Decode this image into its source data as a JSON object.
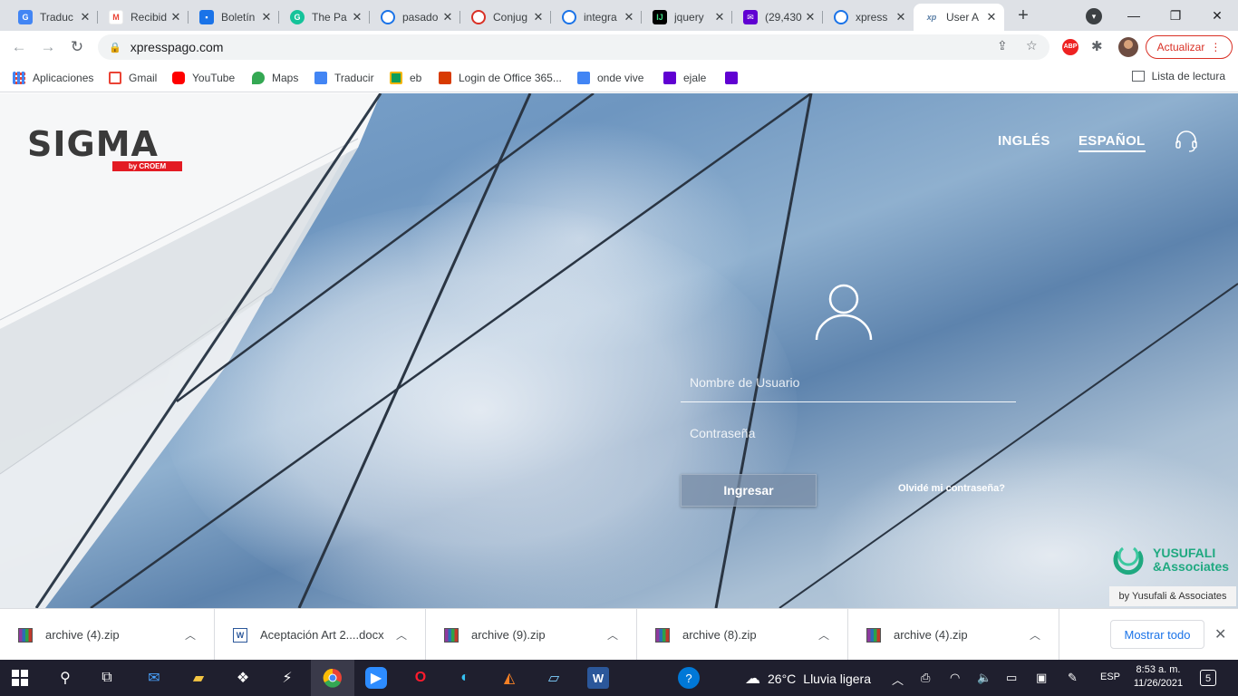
{
  "browser": {
    "tabs": [
      {
        "title": "Traduc",
        "icon": "google-translate-icon",
        "color": "#4285f4"
      },
      {
        "title": "Recibid",
        "icon": "gmail-icon",
        "color": "#ea4335"
      },
      {
        "title": "Boletín",
        "icon": "contacts-icon",
        "color": "#1a73e8"
      },
      {
        "title": "The Pa",
        "icon": "grammarly-icon",
        "color": "#15c39a"
      },
      {
        "title": "pasado",
        "icon": "search-icon",
        "color": "#1a73e8"
      },
      {
        "title": "Conjug",
        "icon": "conjugation-icon",
        "color": "#d93025"
      },
      {
        "title": "integra",
        "icon": "search-icon",
        "color": "#1a73e8"
      },
      {
        "title": "jquery",
        "icon": "intellij-icon",
        "color": "#000000"
      },
      {
        "title": "(29,430",
        "icon": "yahoo-mail-icon",
        "color": "#6001d2"
      },
      {
        "title": "xpress",
        "icon": "search-icon",
        "color": "#1a73e8"
      },
      {
        "title": "User A",
        "icon": "xp-icon",
        "color": "#5b7fa6"
      }
    ],
    "address": "xpresspago.com",
    "update_label": "Actualizar",
    "bookmarks": [
      {
        "label": "Aplicaciones",
        "icon": "apps-grid-icon",
        "color": "#4285f4"
      },
      {
        "label": "Gmail",
        "icon": "gmail-icon",
        "color": "#ea4335"
      },
      {
        "label": "YouTube",
        "icon": "youtube-icon",
        "color": "#ff0000"
      },
      {
        "label": "Maps",
        "icon": "maps-icon",
        "color": "#34a853"
      },
      {
        "label": "Traducir",
        "icon": "google-translate-icon",
        "color": "#4285f4"
      },
      {
        "label": "eb",
        "icon": "classroom-icon",
        "color": "#0f9d58"
      },
      {
        "label": "Login de Office 365...",
        "icon": "office-icon",
        "color": "#d83b01"
      },
      {
        "label": "onde vive",
        "icon": "google-translate-icon",
        "color": "#4285f4"
      },
      {
        "label": "ejale",
        "icon": "yahoo-mail-icon",
        "color": "#6001d2"
      },
      {
        "label": "",
        "icon": "yahoo-mail-icon",
        "color": "#6001d2"
      }
    ],
    "reading_list": "Lista de lectura"
  },
  "page": {
    "logo_word": "SIGMA",
    "logo_sub": "by CROEM",
    "lang_en": "INGLÉS",
    "lang_es": "ESPAÑOL",
    "username_placeholder": "Nombre de Usuario",
    "password_placeholder": "Contraseña",
    "login_label": "Ingresar",
    "forgot_label": "Olvidé mi contraseña?",
    "partner_name_1": "YUSUFALI",
    "partner_name_2": "&Associates",
    "partner_caption": "by Yusufali & Associates",
    "accent": "#e31b23"
  },
  "downloads": {
    "items": [
      {
        "name": "archive (4).zip",
        "icon": "winrar-icon"
      },
      {
        "name": "Aceptación Art 2....docx",
        "icon": "word-doc-icon"
      },
      {
        "name": "archive (9).zip",
        "icon": "winrar-icon"
      },
      {
        "name": "archive (8).zip",
        "icon": "winrar-icon"
      },
      {
        "name": "archive (4).zip",
        "icon": "winrar-icon"
      }
    ],
    "show_all": "Mostrar todo"
  },
  "taskbar": {
    "weather_temp": "26°C",
    "weather_desc": "Lluvia ligera",
    "lang": "ESP",
    "time": "8:53 a. m.",
    "date": "11/26/2021",
    "notifications": "5"
  }
}
